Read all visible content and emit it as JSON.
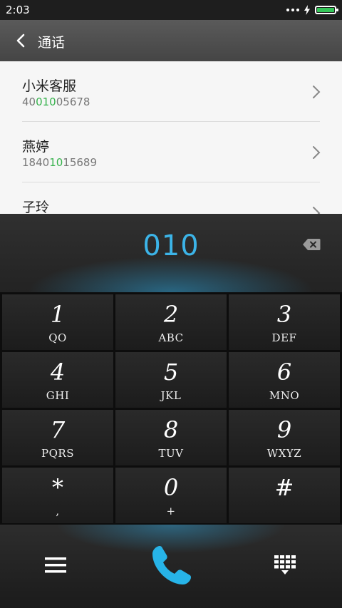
{
  "status_bar": {
    "time": "2:03"
  },
  "header": {
    "title": "通话"
  },
  "contacts": [
    {
      "name": "小米客服",
      "number_before": "40",
      "number_match": "010",
      "number_after": "05678"
    },
    {
      "name": "燕婷",
      "number_before": "1840",
      "number_match": "10",
      "number_after": "15689"
    },
    {
      "name": "子玲",
      "number_before": "",
      "number_match": "",
      "number_after": ""
    }
  ],
  "dialer": {
    "input_value": "010"
  },
  "keypad": [
    {
      "digit": "1",
      "letters": "QO"
    },
    {
      "digit": "2",
      "letters": "ABC"
    },
    {
      "digit": "3",
      "letters": "DEF"
    },
    {
      "digit": "4",
      "letters": "GHI"
    },
    {
      "digit": "5",
      "letters": "JKL"
    },
    {
      "digit": "6",
      "letters": "MNO"
    },
    {
      "digit": "7",
      "letters": "PQRS"
    },
    {
      "digit": "8",
      "letters": "TUV"
    },
    {
      "digit": "9",
      "letters": "WXYZ"
    },
    {
      "digit": "*",
      "letters": ","
    },
    {
      "digit": "0",
      "letters": "+"
    },
    {
      "digit": "#",
      "letters": ""
    }
  ],
  "colors": {
    "accent": "#3cb4e8",
    "match": "#37b24d",
    "battery": "#35c759"
  },
  "icons": {
    "back": "chevron-left-icon",
    "row_arrow": "chevron-right-icon",
    "backspace": "backspace-icon",
    "menu": "menu-icon",
    "call": "phone-icon",
    "dialpad": "dialpad-icon"
  }
}
